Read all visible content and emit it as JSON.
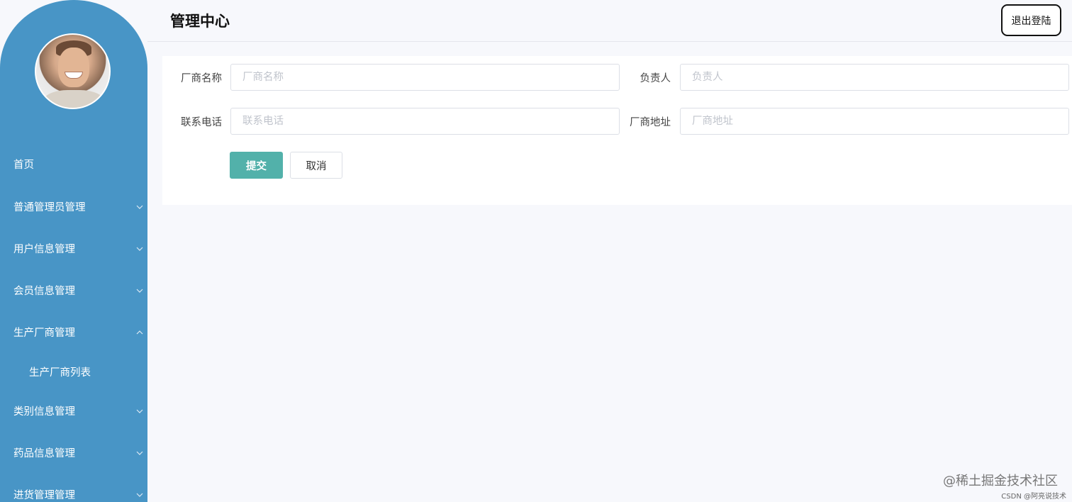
{
  "header": {
    "title": "管理中心",
    "logout_label": "退出登陆"
  },
  "sidebar": {
    "items": [
      {
        "label": "首页",
        "has_chevron": false
      },
      {
        "label": "普通管理员管理",
        "has_chevron": true,
        "chevron": "down"
      },
      {
        "label": "用户信息管理",
        "has_chevron": true,
        "chevron": "down"
      },
      {
        "label": "会员信息管理",
        "has_chevron": true,
        "chevron": "down"
      },
      {
        "label": "生产厂商管理",
        "has_chevron": true,
        "chevron": "up",
        "expanded": true
      },
      {
        "label": "生产厂商列表",
        "submenu": true
      },
      {
        "label": "类别信息管理",
        "has_chevron": true,
        "chevron": "down"
      },
      {
        "label": "药品信息管理",
        "has_chevron": true,
        "chevron": "down"
      },
      {
        "label": "进货管理管理",
        "has_chevron": true,
        "chevron": "down"
      }
    ]
  },
  "form": {
    "manufacturer_name": {
      "label": "厂商名称",
      "placeholder": "厂商名称",
      "value": ""
    },
    "responsible_person": {
      "label": "负责人",
      "placeholder": "负责人",
      "value": ""
    },
    "phone": {
      "label": "联系电话",
      "placeholder": "联系电话",
      "value": ""
    },
    "address": {
      "label": "厂商地址",
      "placeholder": "厂商地址",
      "value": ""
    },
    "submit_label": "提交",
    "cancel_label": "取消"
  },
  "watermark": {
    "main": "@稀土掘金技术社区",
    "small": "CSDN @阿亮说技术"
  },
  "colors": {
    "sidebar": "#4895c6",
    "submit_button": "#52b1aa",
    "background": "#f7f8fc"
  }
}
